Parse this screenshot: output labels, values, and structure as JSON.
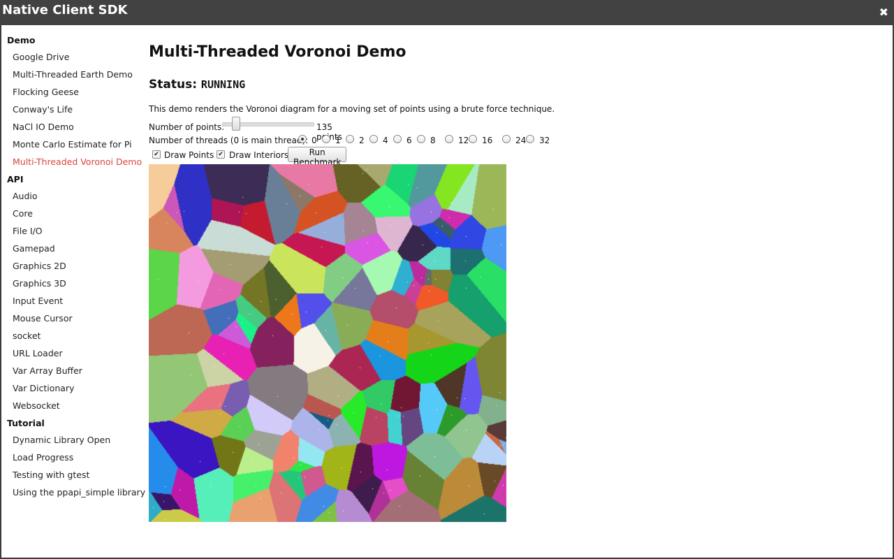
{
  "window": {
    "title": "Native Client SDK",
    "close_glyph": "✖"
  },
  "sidebar": [
    {
      "type": "section",
      "label": "Demo"
    },
    {
      "type": "item",
      "label": "Google Drive"
    },
    {
      "type": "item",
      "label": "Multi-Threaded Earth Demo"
    },
    {
      "type": "item",
      "label": "Flocking Geese"
    },
    {
      "type": "item",
      "label": "Conway's Life"
    },
    {
      "type": "item",
      "label": "NaCl IO Demo"
    },
    {
      "type": "item",
      "label": "Monte Carlo Estimate for Pi"
    },
    {
      "type": "item",
      "label": "Multi-Threaded Voronoi Demo",
      "active": true
    },
    {
      "type": "section",
      "label": "API"
    },
    {
      "type": "item",
      "label": "Audio"
    },
    {
      "type": "item",
      "label": "Core"
    },
    {
      "type": "item",
      "label": "File I/O"
    },
    {
      "type": "item",
      "label": "Gamepad"
    },
    {
      "type": "item",
      "label": "Graphics 2D"
    },
    {
      "type": "item",
      "label": "Graphics 3D"
    },
    {
      "type": "item",
      "label": "Input Event"
    },
    {
      "type": "item",
      "label": "Mouse Cursor"
    },
    {
      "type": "item",
      "label": "socket"
    },
    {
      "type": "item",
      "label": "URL Loader"
    },
    {
      "type": "item",
      "label": "Var Array Buffer"
    },
    {
      "type": "item",
      "label": "Var Dictionary"
    },
    {
      "type": "item",
      "label": "Websocket"
    },
    {
      "type": "section",
      "label": "Tutorial"
    },
    {
      "type": "item",
      "label": "Dynamic Library Open"
    },
    {
      "type": "item",
      "label": "Load Progress"
    },
    {
      "type": "item",
      "label": "Testing with gtest"
    },
    {
      "type": "item",
      "label": "Using the ppapi_simple library"
    }
  ],
  "main": {
    "title": "Multi-Threaded Voronoi Demo",
    "status_label": "Status:",
    "status_value": "RUNNING",
    "description": "This demo renders the Voronoi diagram for a moving set of points using a brute force technique.",
    "points_label": "Number of points:",
    "points_value": "135 points",
    "points_slider_fraction": 0.12,
    "threads_label": "Number of threads (0 is main thread):",
    "thread_options": [
      "0",
      "1",
      "2",
      "4",
      "6",
      "8",
      "12",
      "16",
      "24",
      "32"
    ],
    "thread_selected": "0",
    "draw_points_label": "Draw Points",
    "draw_points_checked": true,
    "draw_interiors_label": "Draw Interiors",
    "draw_interiors_checked": true,
    "benchmark_label": "Run Benchmark"
  }
}
